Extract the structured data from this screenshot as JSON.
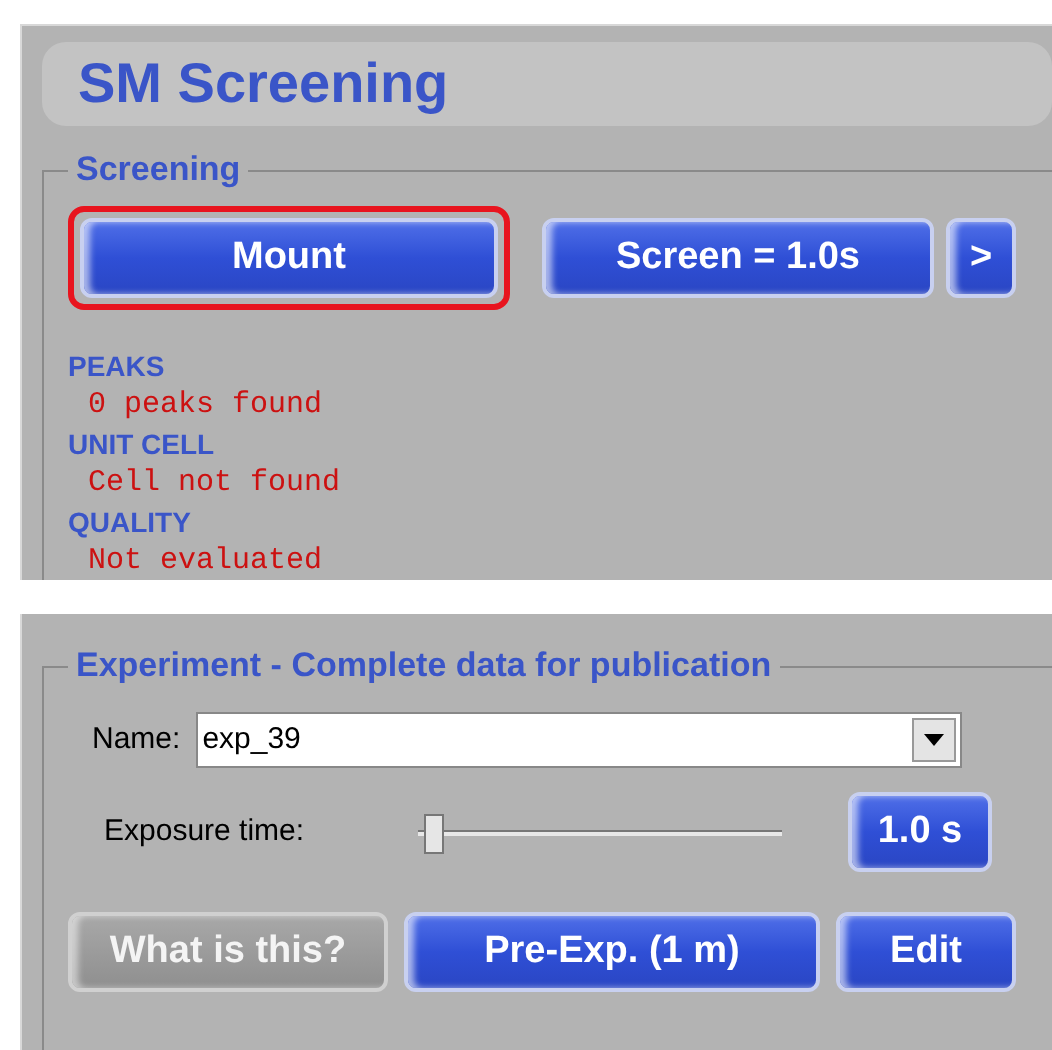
{
  "title": "SM Screening",
  "screening": {
    "legend": "Screening",
    "buttons": [
      {
        "label": "Mount",
        "highlighted": true
      },
      {
        "label": "Screen = 1.0s",
        "highlighted": false
      },
      {
        "label": ">",
        "highlighted": false
      }
    ],
    "results": [
      {
        "heading": "PEAKS",
        "value": "0 peaks found"
      },
      {
        "heading": "UNIT CELL",
        "value": "Cell not found"
      },
      {
        "heading": "QUALITY",
        "value": "Not evaluated"
      }
    ]
  },
  "experiment": {
    "legend": "Experiment - Complete data for publication",
    "name_label": "Name:",
    "name_value": "exp_39",
    "exposure_label": "Exposure time:",
    "exposure": {
      "level": 0.02
    },
    "exposure_button": "1.0 s",
    "buttons": [
      {
        "label": "What is this?",
        "kind": "gray"
      },
      {
        "label": "Pre-Exp. (1 m)",
        "kind": "blue"
      },
      {
        "label": "Edit",
        "kind": "blue"
      }
    ]
  }
}
